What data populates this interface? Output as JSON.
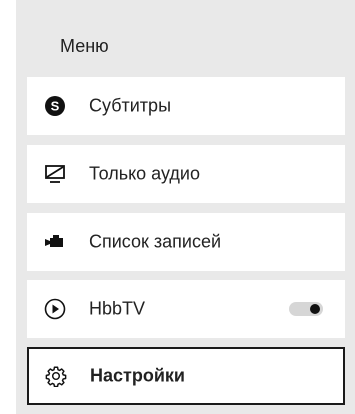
{
  "menu": {
    "title": "Меню",
    "items": [
      {
        "label": "Субтитры",
        "icon": "subtitles-s-icon"
      },
      {
        "label": "Только аудио",
        "icon": "screen-off-icon"
      },
      {
        "label": "Список записей",
        "icon": "video-camera-icon"
      },
      {
        "label": "HbbTV",
        "icon": "play-circle-icon",
        "toggle_on": true
      },
      {
        "label": "Настройки",
        "icon": "gear-icon",
        "selected": true
      }
    ]
  },
  "colors": {
    "panel_background": "#e9e9e9",
    "item_background": "#ffffff",
    "text": "#222222",
    "selected_border": "#1a1a1a",
    "toggle_track": "#d6d6d6",
    "toggle_knob": "#111111"
  }
}
